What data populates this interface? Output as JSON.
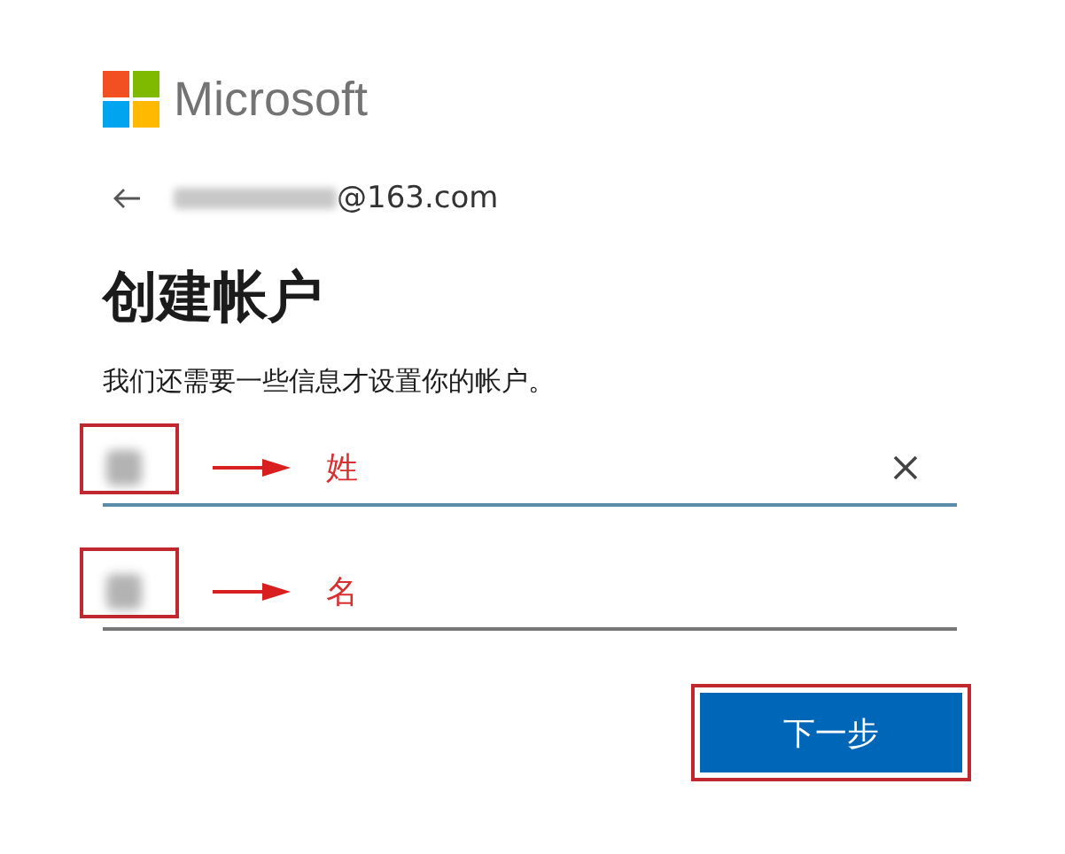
{
  "logo": {
    "text": "Microsoft"
  },
  "account": {
    "email_suffix": "@163.com"
  },
  "title": "创建帐户",
  "subtitle": "我们还需要一些信息才设置你的帐户。",
  "fields": [
    {
      "annotation": "姓",
      "focused": true,
      "highlighted": true
    },
    {
      "annotation": "名",
      "focused": false,
      "highlighted": true
    }
  ],
  "next_button": {
    "label": "下一步",
    "highlighted": true
  }
}
